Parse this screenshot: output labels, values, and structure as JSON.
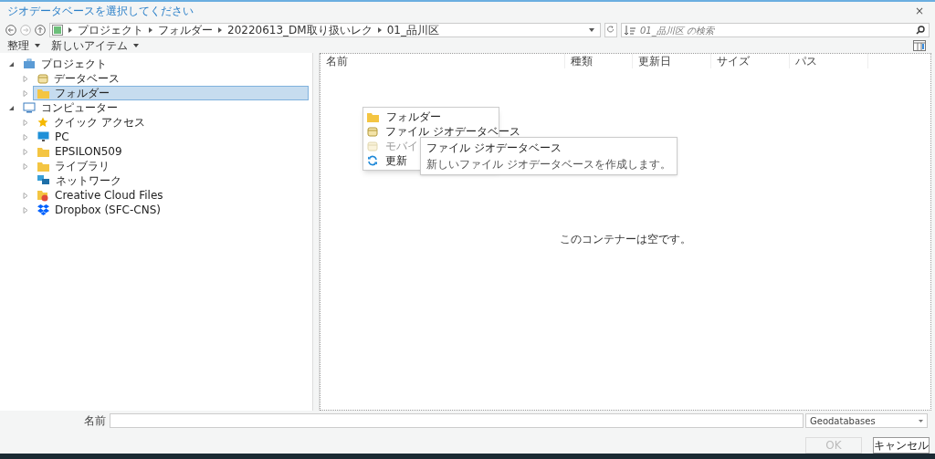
{
  "window": {
    "title": "ジオデータベースを選択してください",
    "close": "×"
  },
  "breadcrumb": [
    "プロジェクト",
    "フォルダー",
    "20220613_DM取り扱いレク",
    "01_品川区"
  ],
  "search": {
    "placeholder": "01_品川区 の検索"
  },
  "toolbar": [
    {
      "label": "整理"
    },
    {
      "label": "新しいアイテム"
    }
  ],
  "tree": [
    {
      "label": "プロジェクト",
      "kind": "project",
      "expanded": true,
      "selected": false,
      "children": [
        {
          "label": "データベース",
          "kind": "database",
          "expanded": false,
          "selected": false
        },
        {
          "label": "フォルダー",
          "kind": "folder",
          "expanded": false,
          "selected": true
        }
      ]
    },
    {
      "label": "コンピューター",
      "kind": "computer",
      "expanded": true,
      "selected": false,
      "children": [
        {
          "label": "クイック アクセス",
          "kind": "favorite",
          "expanded": false,
          "selected": false
        },
        {
          "label": "PC",
          "kind": "pc",
          "expanded": false,
          "selected": false
        },
        {
          "label": "EPSILON509",
          "kind": "folder",
          "expanded": false,
          "selected": false
        },
        {
          "label": "ライブラリ",
          "kind": "folder",
          "expanded": false,
          "selected": false
        },
        {
          "label": "ネットワーク",
          "kind": "network",
          "selected": false
        },
        {
          "label": "Creative Cloud Files",
          "kind": "cloud",
          "expanded": false,
          "selected": false
        },
        {
          "label": "Dropbox (SFC-CNS)",
          "kind": "dropbox",
          "expanded": false,
          "selected": false
        }
      ]
    }
  ],
  "table": {
    "columns": [
      "名前",
      "種類",
      "更新日",
      "サイズ",
      "パス"
    ],
    "empty_message": "このコンテナーは空です。"
  },
  "context_menu": [
    {
      "label": "フォルダー",
      "kind": "folder",
      "disabled": false
    },
    {
      "label": "ファイル ジオデータベース",
      "kind": "database",
      "disabled": false
    },
    {
      "label": "モバイ",
      "kind": "database",
      "disabled": true
    },
    {
      "label": "更新",
      "kind": "refresh",
      "disabled": false
    }
  ],
  "tooltip": {
    "title": "ファイル ジオデータベース",
    "text": "新しいファイル ジオデータベースを作成します。"
  },
  "name_field": {
    "label": "名前"
  },
  "filter": {
    "value": "Geodatabases"
  },
  "buttons": [
    {
      "label": "OK",
      "disabled": true
    },
    {
      "label": "キャンセル",
      "disabled": false
    }
  ]
}
